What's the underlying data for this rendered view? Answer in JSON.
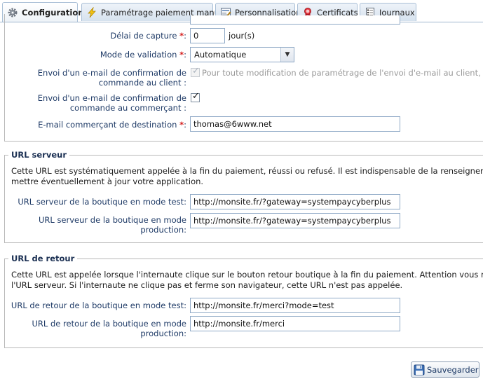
{
  "tabs": [
    {
      "label": "Configuration",
      "icon": "gear-icon",
      "active": true
    },
    {
      "label": "Paramétrage paiement manuel",
      "icon": "lightning-icon",
      "active": false
    },
    {
      "label": "Personnalisation",
      "icon": "edit-form-icon",
      "active": false
    },
    {
      "label": "Certificats",
      "icon": "ribbon-award-icon",
      "active": false
    },
    {
      "label": "Journaux",
      "icon": "log-document-icon",
      "active": false
    }
  ],
  "config": {
    "delai_label": "Délai de capture",
    "delai_value": "0",
    "delai_unit": "jour(s)",
    "mode_label": "Mode de validation",
    "mode_value": "Automatique",
    "email_client_label_line1": "Envoi d'un e-mail de confirmation de",
    "email_client_label_line2": "commande au client :",
    "email_client_checked": true,
    "email_client_note": "Pour toute modification de paramétrage de l'envoi d'e-mail au client, m",
    "email_merchant_label_line1": "Envoi d'un e-mail de confirmation de",
    "email_merchant_label_line2": "commande au commerçant :",
    "email_merchant_checked": true,
    "dest_label": "E-mail commerçant de destination",
    "dest_value": "thomas@6www.net",
    "required_marker": "*",
    "colon": ":"
  },
  "url_serveur": {
    "legend": "URL serveur",
    "desc_line1": "Cette URL est systématiquement appelée à la fin du paiement, réussi ou refusé. Il est indispensable de la renseigner a",
    "desc_line2": "mettre éventuellement à jour votre application.",
    "test_label": "URL serveur de la boutique en mode test:",
    "test_value": "http://monsite.fr/?gateway=systempaycyberplus",
    "prod_label_line1": "URL serveur de la boutique en mode",
    "prod_label_line2": "production:",
    "prod_value": "http://monsite.fr/?gateway=systempaycyberplus"
  },
  "url_retour": {
    "legend": "URL de retour",
    "desc_line1": "Cette URL est appelée lorsque l'internaute clique sur le bouton retour boutique à la fin du paiement. Attention vous ne",
    "desc_line2": "l'URL serveur. Si l'internaute ne clique pas et ferme son navigateur, cette URL n'est pas appelée.",
    "test_label": "URL de retour de la boutique en mode test:",
    "test_value": "http://monsite.fr/merci?mode=test",
    "prod_label_line1": "URL de retour de la boutique en mode",
    "prod_label_line2": "production:",
    "prod_value": "http://monsite.fr/merci"
  },
  "save_label": "Sauvegarder"
}
